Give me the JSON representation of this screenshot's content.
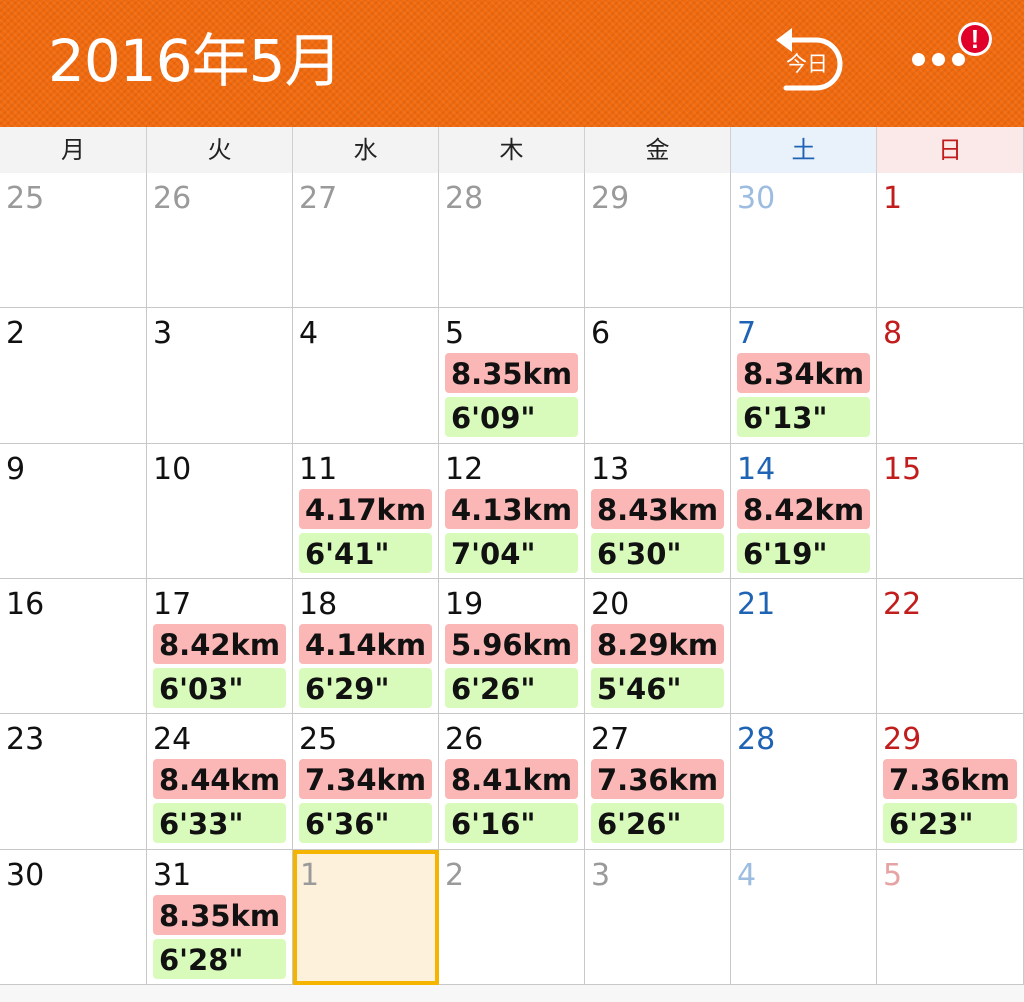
{
  "header": {
    "title": "2016年5月",
    "today_label": "今日",
    "alert_badge": "!",
    "accent_color": "#f26a0e"
  },
  "weekdays": [
    {
      "label": "月",
      "kind": "weekday"
    },
    {
      "label": "火",
      "kind": "weekday"
    },
    {
      "label": "水",
      "kind": "weekday"
    },
    {
      "label": "木",
      "kind": "weekday"
    },
    {
      "label": "金",
      "kind": "weekday"
    },
    {
      "label": "土",
      "kind": "sat"
    },
    {
      "label": "日",
      "kind": "sun"
    }
  ],
  "weeks": [
    [
      {
        "day": "25",
        "other": true
      },
      {
        "day": "26",
        "other": true
      },
      {
        "day": "27",
        "other": true
      },
      {
        "day": "28",
        "other": true
      },
      {
        "day": "29",
        "other": true
      },
      {
        "day": "30",
        "other": true
      },
      {
        "day": "1"
      }
    ],
    [
      {
        "day": "2"
      },
      {
        "day": "3"
      },
      {
        "day": "4"
      },
      {
        "day": "5",
        "distance": "8.35km",
        "pace": "6'09\""
      },
      {
        "day": "6"
      },
      {
        "day": "7",
        "distance": "8.34km",
        "pace": "6'13\""
      },
      {
        "day": "8"
      }
    ],
    [
      {
        "day": "9"
      },
      {
        "day": "10"
      },
      {
        "day": "11",
        "distance": "4.17km",
        "pace": "6'41\""
      },
      {
        "day": "12",
        "distance": "4.13km",
        "pace": "7'04\""
      },
      {
        "day": "13",
        "distance": "8.43km",
        "pace": "6'30\""
      },
      {
        "day": "14",
        "distance": "8.42km",
        "pace": "6'19\""
      },
      {
        "day": "15"
      }
    ],
    [
      {
        "day": "16"
      },
      {
        "day": "17",
        "distance": "8.42km",
        "pace": "6'03\""
      },
      {
        "day": "18",
        "distance": "4.14km",
        "pace": "6'29\""
      },
      {
        "day": "19",
        "distance": "5.96km",
        "pace": "6'26\""
      },
      {
        "day": "20",
        "distance": "8.29km",
        "pace": "5'46\""
      },
      {
        "day": "21"
      },
      {
        "day": "22"
      }
    ],
    [
      {
        "day": "23"
      },
      {
        "day": "24",
        "distance": "8.44km",
        "pace": "6'33\""
      },
      {
        "day": "25",
        "distance": "7.34km",
        "pace": "6'36\""
      },
      {
        "day": "26",
        "distance": "8.41km",
        "pace": "6'16\""
      },
      {
        "day": "27",
        "distance": "7.36km",
        "pace": "6'26\""
      },
      {
        "day": "28"
      },
      {
        "day": "29",
        "distance": "7.36km",
        "pace": "6'23\""
      }
    ],
    [
      {
        "day": "30"
      },
      {
        "day": "31",
        "distance": "8.35km",
        "pace": "6'28\""
      },
      {
        "day": "1",
        "other": true,
        "selected": true
      },
      {
        "day": "2",
        "other": true
      },
      {
        "day": "3",
        "other": true
      },
      {
        "day": "4",
        "other": true
      },
      {
        "day": "5",
        "other": true
      }
    ]
  ]
}
